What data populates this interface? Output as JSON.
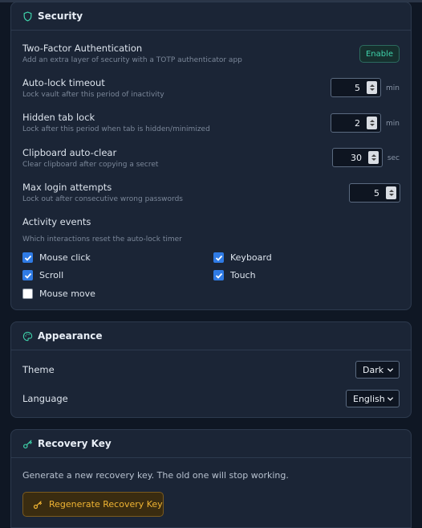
{
  "security": {
    "title": "Security",
    "two_factor": {
      "label": "Two-Factor Authentication",
      "desc": "Add an extra layer of security with a TOTP authenticator app",
      "button": "Enable"
    },
    "auto_lock": {
      "label": "Auto-lock timeout",
      "desc": "Lock vault after this period of inactivity",
      "value": "5",
      "unit": "min"
    },
    "hidden_tab": {
      "label": "Hidden tab lock",
      "desc": "Lock after this period when tab is hidden/minimized",
      "value": "2",
      "unit": "min"
    },
    "clipboard": {
      "label": "Clipboard auto-clear",
      "desc": "Clear clipboard after copying a secret",
      "value": "30",
      "unit": "sec"
    },
    "max_login": {
      "label": "Max login attempts",
      "desc": "Lock out after consecutive wrong passwords",
      "value": "5"
    },
    "activity": {
      "label": "Activity events",
      "desc": "Which interactions reset the auto-lock timer",
      "events": [
        {
          "label": "Mouse click",
          "checked": true
        },
        {
          "label": "Keyboard",
          "checked": true
        },
        {
          "label": "Scroll",
          "checked": true
        },
        {
          "label": "Touch",
          "checked": true
        },
        {
          "label": "Mouse move",
          "checked": false
        }
      ]
    }
  },
  "appearance": {
    "title": "Appearance",
    "theme": {
      "label": "Theme",
      "value": "Dark"
    },
    "language": {
      "label": "Language",
      "value": "English"
    }
  },
  "recovery": {
    "title": "Recovery Key",
    "desc": "Generate a new recovery key. The old one will stop working.",
    "button": "Regenerate Recovery Key"
  },
  "colors": {
    "background": "#0f1724",
    "card": "#1b2536",
    "accent_teal": "#3fd3ab",
    "accent_blue": "#2f7be5",
    "warning_amber": "#f0b433"
  }
}
